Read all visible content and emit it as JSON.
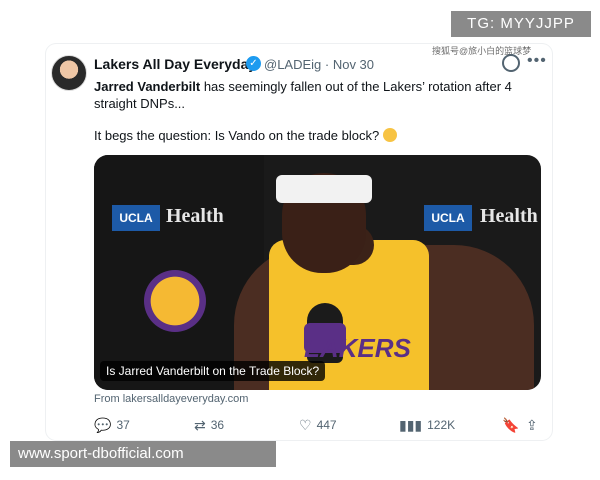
{
  "watermarks": {
    "tg": "TG: MYYJJPP",
    "cn": "搜狐号@旅小白的篮球梦",
    "site": "www.sport-dbofficial.com"
  },
  "tweet": {
    "author_name": "Lakers All Day Everyday",
    "verified_icon": "verified-badge-icon",
    "handle_date": "@LADEig · Nov 30",
    "line1_bold": "Jarred Vanderbilt",
    "line1_rest": " has seemingly fallen out of the Lakers’ rotation after 4 straight DNPs...",
    "line2": "It begs the question: Is Vando on the trade block?",
    "media": {
      "left_brand_box": "UCLA",
      "left_brand_text": "Health",
      "right_brand_box": "UCLA",
      "right_brand_text": "Health",
      "jersey_text": "LAKERS",
      "caption": "Is Jarred Vanderbilt on the Trade Block?"
    },
    "source": "From lakersalldayeveryday.com",
    "actions": {
      "replies": "37",
      "retweets": "36",
      "likes": "447",
      "views": "122K"
    }
  }
}
